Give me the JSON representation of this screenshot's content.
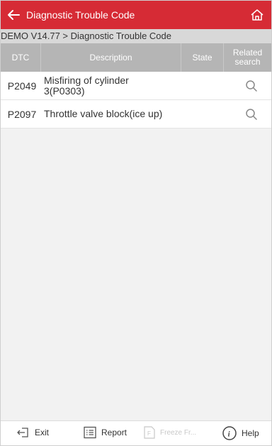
{
  "header": {
    "title": "Diagnostic Trouble Code",
    "back_icon": "arrow-left-icon",
    "home_icon": "home-icon"
  },
  "breadcrumb": "DEMO V14.77 > Diagnostic Trouble Code",
  "table": {
    "columns": [
      "DTC",
      "Description",
      "State",
      "Related search"
    ],
    "rows": [
      {
        "dtc": "P2049",
        "description": "Misfiring of cylinder 3(P0303)",
        "state": ""
      },
      {
        "dtc": "P2097",
        "description": "Throttle valve block(ice up)",
        "state": ""
      }
    ]
  },
  "footer": {
    "exit": "Exit",
    "report": "Report",
    "freeze": "Freeze Fr...",
    "help": "Help"
  },
  "colors": {
    "accent": "#d62b35",
    "header_bg": "#b5b5b5"
  }
}
